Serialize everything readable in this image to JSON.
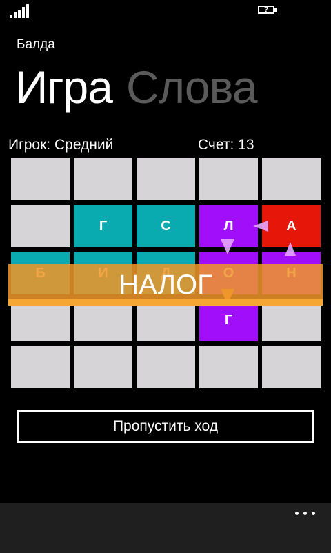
{
  "status_bar": {
    "signal_icon": "signal-strength-icon",
    "battery_icon": "battery-charging-icon",
    "battery_mark": "?"
  },
  "app": {
    "title": "Балда"
  },
  "pivot": {
    "items": [
      {
        "label": "Игра",
        "active": true
      },
      {
        "label": "Слова",
        "active": false
      }
    ]
  },
  "info": {
    "player": "Игрок: Средний",
    "score": "Счет: 13"
  },
  "board": {
    "rows": [
      [
        {
          "letter": "",
          "color": "empty"
        },
        {
          "letter": "",
          "color": "empty"
        },
        {
          "letter": "",
          "color": "empty"
        },
        {
          "letter": "",
          "color": "empty"
        },
        {
          "letter": "",
          "color": "empty"
        }
      ],
      [
        {
          "letter": "",
          "color": "empty"
        },
        {
          "letter": "Г",
          "color": "teal"
        },
        {
          "letter": "С",
          "color": "teal"
        },
        {
          "letter": "Л",
          "color": "purple"
        },
        {
          "letter": "А",
          "color": "red"
        }
      ],
      [
        {
          "letter": "Б",
          "color": "teal"
        },
        {
          "letter": "И",
          "color": "teal"
        },
        {
          "letter": "Д",
          "color": "teal"
        },
        {
          "letter": "О",
          "color": "purple"
        },
        {
          "letter": "Н",
          "color": "purple"
        }
      ],
      [
        {
          "letter": "",
          "color": "empty"
        },
        {
          "letter": "",
          "color": "empty"
        },
        {
          "letter": "",
          "color": "empty"
        },
        {
          "letter": "Г",
          "color": "purple"
        },
        {
          "letter": "",
          "color": "empty"
        }
      ],
      [
        {
          "letter": "",
          "color": "empty"
        },
        {
          "letter": "",
          "color": "empty"
        },
        {
          "letter": "",
          "color": "empty"
        },
        {
          "letter": "",
          "color": "empty"
        },
        {
          "letter": "",
          "color": "empty"
        }
      ]
    ],
    "path_arrows_icon": "word-path-arrows-icon"
  },
  "overlay": {
    "word": "НАЛОГ"
  },
  "actions": {
    "skip_turn": "Пропустить ход"
  },
  "app_bar": {
    "more_icon": "ellipsis-icon"
  },
  "colors": {
    "empty_cell": "#d6d4d6",
    "teal": "#09aab0",
    "purple": "#a10ffa",
    "red": "#e61608",
    "overlay": "#f09628",
    "inactive_pivot": "#5a5a5a"
  }
}
